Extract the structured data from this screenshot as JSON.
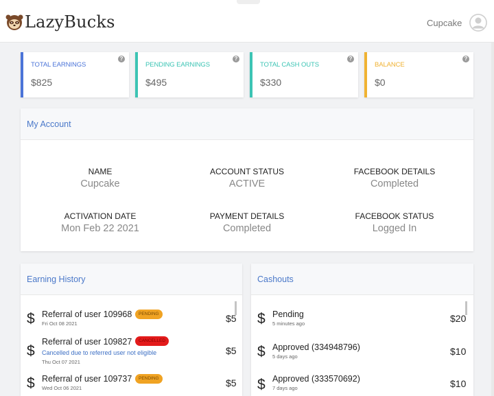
{
  "header": {
    "brand": "LazyBucks",
    "user_name": "Cupcake"
  },
  "stats": [
    {
      "label": "TOTAL EARNINGS",
      "value": "$825",
      "color": "#4b74d8"
    },
    {
      "label": "PENDING EARNINGS",
      "value": "$495",
      "color": "#3cc4b4"
    },
    {
      "label": "TOTAL CASH OUTS",
      "value": "$330",
      "color": "#3cc4b4"
    },
    {
      "label": "BALANCE",
      "value": "$0",
      "color": "#f0b232"
    }
  ],
  "account": {
    "title": "My Account",
    "fields": [
      {
        "key": "NAME",
        "value": "Cupcake"
      },
      {
        "key": "ACCOUNT STATUS",
        "value": "ACTIVE"
      },
      {
        "key": "FACEBOOK DETAILS",
        "value": "Completed"
      },
      {
        "key": "ACTIVATION DATE",
        "value": "Mon Feb 22 2021"
      },
      {
        "key": "PAYMENT DETAILS",
        "value": "Completed"
      },
      {
        "key": "FACEBOOK STATUS",
        "value": "Logged In"
      }
    ]
  },
  "earning_history": {
    "title": "Earning History",
    "rows": [
      {
        "title": "Referral of user 109968",
        "badge": "PENDING",
        "date": "Fri Oct 08 2021",
        "note": "",
        "amount": "$5"
      },
      {
        "title": "Referral of user 109827",
        "badge": "CANCELLED",
        "date": "Thu Oct 07 2021",
        "note": "Cancelled due to referred user not eligible",
        "amount": "$5"
      },
      {
        "title": "Referral of user 109737",
        "badge": "PENDING",
        "date": "Wed Oct 06 2021",
        "note": "",
        "amount": "$5"
      }
    ]
  },
  "cashouts": {
    "title": "Cashouts",
    "rows": [
      {
        "title": "Pending",
        "date": "5 minutes ago",
        "amount": "$20"
      },
      {
        "title": "Approved (334948796)",
        "date": "5 days ago",
        "amount": "$10"
      },
      {
        "title": "Approved (333570692)",
        "date": "7 days ago",
        "amount": "$10"
      }
    ]
  },
  "icons": {
    "help": "?",
    "dollar": "$"
  }
}
